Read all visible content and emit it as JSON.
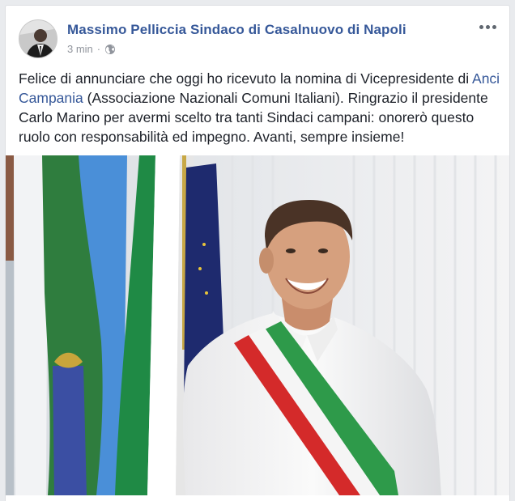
{
  "post": {
    "author": "Massimo Pelliccia Sindaco di Casalnuovo di Napoli",
    "time": "3 min",
    "privacy_icon": "globe-icon",
    "more_icon": "more-options-icon",
    "text_part1": "Felice di annunciare che oggi ho ricevuto la nomina di Vicepresidente di ",
    "link_text": "Anci Campania",
    "text_part2": " (Associazione Nazionali Comuni Italiani). Ringrazio il presidente Carlo Marino per avermi scelto tra tanti Sindaci campani: onorerò questo ruolo con responsabilità ed impegno. Avanti, sempre insieme!"
  },
  "colors": {
    "author_link": "#365899",
    "meta": "#90949c",
    "text": "#1d2129",
    "sash_green": "#2e9a4a",
    "sash_white": "#f5f5f5",
    "sash_red": "#d42a2a"
  }
}
